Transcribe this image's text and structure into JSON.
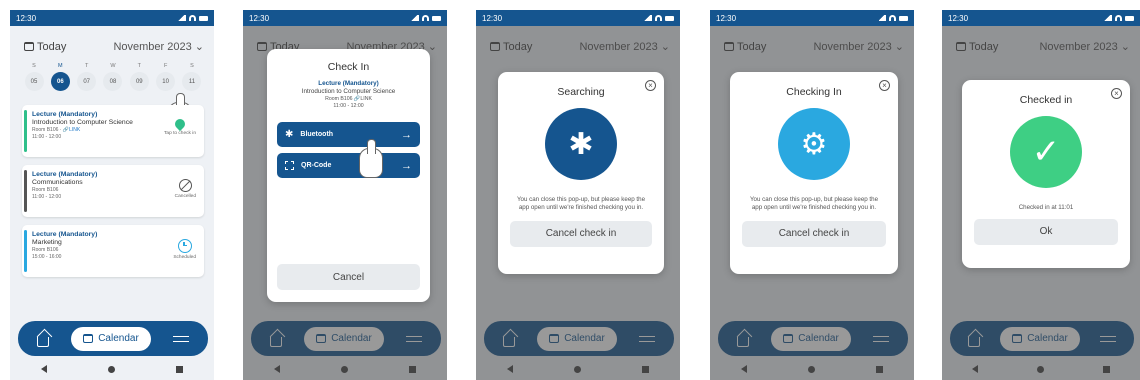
{
  "status": {
    "time": "12:30"
  },
  "header": {
    "today_label": "Today",
    "month_label": "November 2023 ⌄"
  },
  "week": {
    "letters": [
      "S",
      "M",
      "T",
      "W",
      "T",
      "F",
      "S"
    ],
    "dates": [
      "05",
      "06",
      "07",
      "08",
      "09",
      "10",
      "11"
    ],
    "selected_index": 1
  },
  "lectures": [
    {
      "title": "Lecture (Mandatory)",
      "course": "Introduction to Computer Science",
      "room": "Room B106 · ",
      "link": "🔗LINK",
      "time": "11:00 - 12:00",
      "status": "Tap to check in",
      "status_icon": "location-pin-icon",
      "bar": "#2fbf8a"
    },
    {
      "title": "Lecture (Mandatory)",
      "course": "Communications",
      "room": "Room B106",
      "link": "",
      "time": "11:00 - 12:00",
      "status": "Cancelled",
      "status_icon": "cancelled-icon",
      "bar": "#555555"
    },
    {
      "title": "Lecture (Mandatory)",
      "course": "Marketing",
      "room": "Room B106",
      "link": "",
      "time": "15:00 - 16:00",
      "status": "Scheduled",
      "status_icon": "clock-icon",
      "bar": "#2aa8e0"
    }
  ],
  "nav": {
    "calendar_label": "Calendar"
  },
  "checkin_modal": {
    "title": "Check In",
    "lecture": "Lecture (Mandatory)",
    "course": "Introduction to Computer Science",
    "room": "Room B106  🔗LINK",
    "time": "11:00 - 12:00",
    "bluetooth_label": "Bluetooth",
    "qr_label": "QR-Code",
    "cancel_label": "Cancel"
  },
  "searching_modal": {
    "title": "Searching",
    "message": "You can close this pop-up, but please keep the app open until we're finished checking you in.",
    "cancel_label": "Cancel check in"
  },
  "checking_modal": {
    "title": "Checking In",
    "message": "You can close this pop-up, but please keep the app open until we're finished checking you in.",
    "cancel_label": "Cancel check in"
  },
  "checked_modal": {
    "title": "Checked in",
    "message": "Checked in at 11:01",
    "ok_label": "Ok"
  },
  "colors": {
    "primary": "#15558f",
    "accent_blue": "#2aa8e0",
    "success": "#3ecf84"
  }
}
